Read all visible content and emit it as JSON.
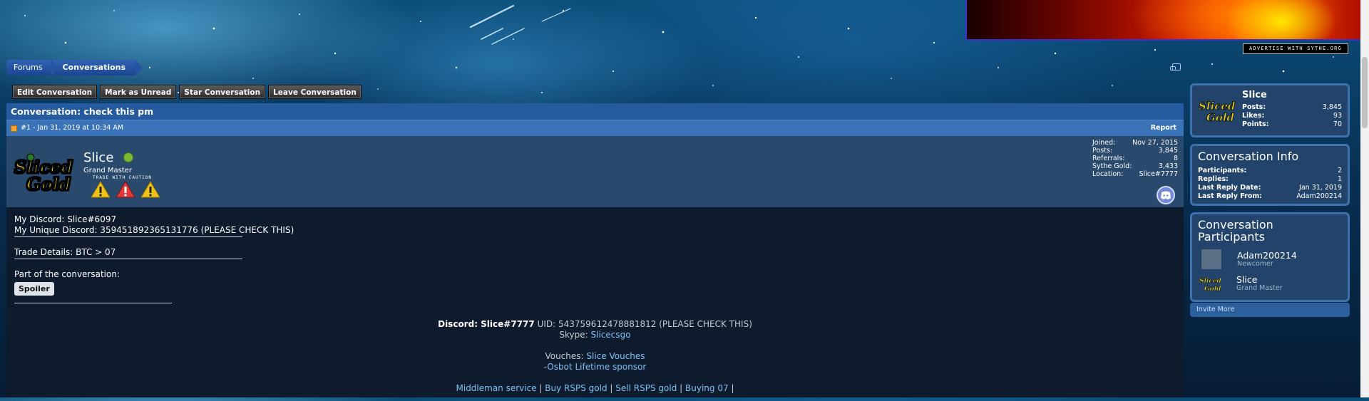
{
  "banner": {
    "advertise_text": "ADVERTISE WITH SYTHE.ORG"
  },
  "breadcrumb": {
    "items": [
      "Forums",
      "Conversations"
    ]
  },
  "toolbar": {
    "buttons": [
      "Edit Conversation",
      "Mark as Unread",
      "Star Conversation",
      "Leave Conversation"
    ]
  },
  "conversation": {
    "title": "Conversation: check this pm",
    "post_meta": "#1 - Jan 31, 2019 at 10:34 AM",
    "report_label": "Report"
  },
  "author": {
    "logo_text": "SlicedGold",
    "name": "Slice",
    "rank": "Grand Master",
    "caution_label": "TRADE WITH CAUTION",
    "stats": [
      {
        "label": "Joined:",
        "value": "Nov 27, 2015"
      },
      {
        "label": "Posts:",
        "value": "3,845"
      },
      {
        "label": "Referrals:",
        "value": "8"
      },
      {
        "label": "Sythe Gold:",
        "value": "3,433"
      },
      {
        "label": "Location:",
        "value": "Slice#7777"
      }
    ]
  },
  "message": {
    "lines": [
      "My Discord: Slice#6097",
      "My Unique Discord: 359451892365131776 (PLEASE CHECK THIS)"
    ],
    "trade_details": "Trade Details: BTC > 07",
    "part_label": "Part of the conversation:",
    "spoiler_label": "Spoiler"
  },
  "signature": {
    "discord_label": "Discord: Slice#7777",
    "uid_text": "UID: 543759612478881812 (PLEASE CHECK THIS)",
    "skype_label": "Skype:",
    "skype_value": "Slicecsgo",
    "vouches_label": "Vouches:",
    "vouches_link": "Slice Vouches",
    "osbot_text": "-Osbot Lifetime sponsor",
    "links": [
      "Middleman service",
      "Buy RSPS gold",
      "Sell RSPS gold",
      "Buying 07"
    ],
    "separator": "|"
  },
  "sidebar": {
    "profile": {
      "name": "Slice",
      "stats": [
        {
          "label": "Posts:",
          "value": "3,845"
        },
        {
          "label": "Likes:",
          "value": "93"
        },
        {
          "label": "Points:",
          "value": "70"
        }
      ]
    },
    "info": {
      "title": "Conversation Info",
      "stats": [
        {
          "label": "Participants:",
          "value": "2"
        },
        {
          "label": "Replies:",
          "value": "1"
        },
        {
          "label": "Last Reply Date:",
          "value": "Jan 31, 2019"
        },
        {
          "label": "Last Reply From:",
          "value": "Adam200214"
        }
      ]
    },
    "participants": {
      "title": "Conversation Participants",
      "people": [
        {
          "name": "Adam200214",
          "rank": "Newcomer"
        },
        {
          "name": "Slice",
          "rank": "Grand Master"
        }
      ],
      "invite_label": "Invite More"
    }
  },
  "colors": {
    "header_blue": "#255b9e",
    "post_head_blue": "#3a73b8",
    "user_row": "#29496d",
    "body_bg": "#0d1b2c",
    "link": "#7ec2f5",
    "online_green": "#7ab833",
    "warning_yellow": "#f3c21a",
    "warning_red": "#e23a3a"
  }
}
